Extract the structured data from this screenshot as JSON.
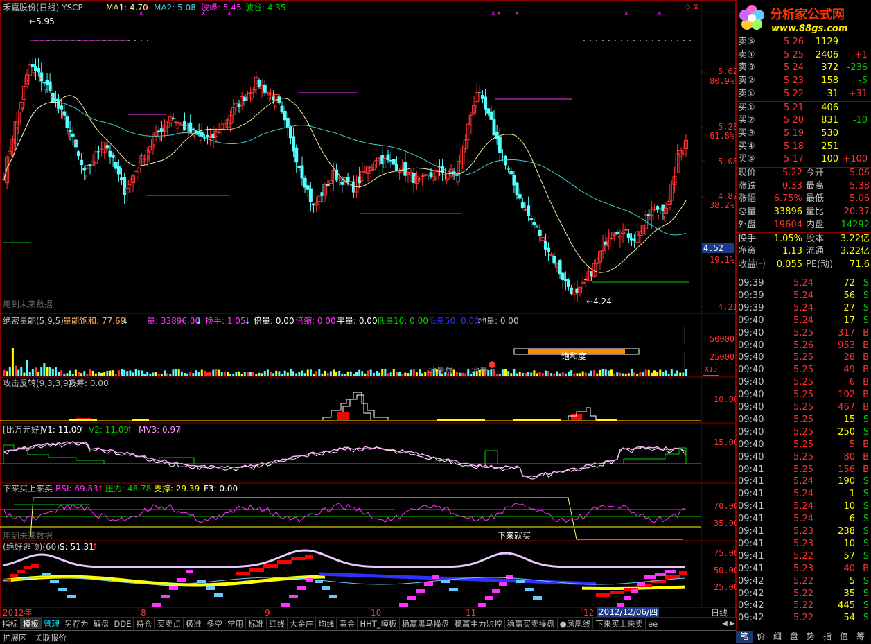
{
  "colors": {
    "up": "#ff3232",
    "down": "#54ffff",
    "bg": "#000000",
    "grid": "#8b0000",
    "yellow": "#ffff00",
    "white": "#ffffff",
    "green": "#00d000",
    "ma1": "#f0f0a0",
    "ma2": "#44cccc",
    "magenta": "#ff33ff",
    "blue": "#3030ff",
    "lightblue": "#66ccff",
    "lavender": "#e6c8ff"
  },
  "main": {
    "title": "禾嘉股份(日线) YSCP",
    "ma1": "MA1: 4.70",
    "ma2": "MA2: 5.03",
    "peak": "波峰: 5.45",
    "valley": "波谷: 4.35",
    "watermark": "用到未来数据",
    "high_label": "5.95",
    "low_label": "4.24",
    "axis": [
      {
        "v": "5.62",
        "c": "#ff3232"
      },
      {
        "v": "80.9%",
        "c": "#ff3232"
      },
      {
        "v": "5.28",
        "c": "#ff3232"
      },
      {
        "v": "61.8%",
        "c": "#ff3232"
      },
      {
        "v": "5.08",
        "c": "#ff3232"
      },
      {
        "v": "4.87",
        "c": "#ff3232"
      },
      {
        "v": "38.2%",
        "c": "#ff3232"
      },
      {
        "v": "19.1%",
        "c": "#ff3232"
      },
      {
        "v": "4.21",
        "c": "#ff3232"
      }
    ],
    "cursor_price": "4.52"
  },
  "chart_data": {
    "type": "candlestick",
    "y_axis": [
      4.21,
      4.87,
      5.08,
      5.28,
      5.62
    ],
    "fib_levels": [
      "19.1%",
      "38.2%",
      "61.8%",
      "80.9%"
    ],
    "high": 5.95,
    "low": 4.24
  },
  "p1": {
    "name": "绝密量能(5,9,5)",
    "sat": "量能饱和: 77.69",
    "vol": "量: 33896.00",
    "turnover": "换手: 1.05",
    "times": "倍量: 0.00",
    "shrink": "倍缩: 0.00",
    "flat": "平量: 0.00",
    "low10": "低量10: 0.00",
    "low50": "低量50: 0.00",
    "ground": "地量: 0.00",
    "axis": [
      "50000",
      "25000"
    ],
    "x10": "X10",
    "saturation_label": "饱和度",
    "ground_group": "地量群",
    "ground_vol": "地量"
  },
  "p2": {
    "name": "攻击反转(9,3,3,9)",
    "chip": "吸筹: 0.00",
    "axis": [
      "10.00"
    ]
  },
  "p3": {
    "name": "[比万元好]",
    "v1": "V1: 11.09",
    "v2": "V2: 11.09",
    "mv3": "MV3: 0.97",
    "axis": [
      "15.00"
    ]
  },
  "p4": {
    "name": "下来买上来卖",
    "rsi": "RSI: 69.83",
    "res": "压力: 48.78",
    "sup": "支撑: 29.39",
    "f3": "F3: 0.00",
    "axis": [
      "70.00",
      "35.00"
    ],
    "watermark": "用到未来数据",
    "note": "下来就买"
  },
  "p5": {
    "name": "(绝好逃顶)(60)",
    "s": "S: 51.31",
    "axis": [
      "75.00",
      "50.00",
      "25.00"
    ]
  },
  "xaxis": {
    "labels": [
      "2012年",
      "8",
      "9",
      "10",
      "11",
      "12"
    ],
    "current": "2012/12/06/四",
    "period": "日线"
  },
  "quote": {
    "asks": [
      {
        "l": "卖⑤",
        "p": "5.26",
        "v": "1129",
        "d": ""
      },
      {
        "l": "卖④",
        "p": "5.25",
        "v": "2406",
        "d": "+1"
      },
      {
        "l": "卖③",
        "p": "5.24",
        "v": "372",
        "d": "-236"
      },
      {
        "l": "卖②",
        "p": "5.23",
        "v": "158",
        "d": "-5"
      },
      {
        "l": "卖①",
        "p": "5.22",
        "v": "31",
        "d": "+31"
      }
    ],
    "bids": [
      {
        "l": "买①",
        "p": "5.21",
        "v": "406",
        "d": ""
      },
      {
        "l": "买②",
        "p": "5.20",
        "v": "831",
        "d": "-10"
      },
      {
        "l": "买③",
        "p": "5.19",
        "v": "530",
        "d": ""
      },
      {
        "l": "买④",
        "p": "5.18",
        "v": "251",
        "d": ""
      },
      {
        "l": "买⑤",
        "p": "5.17",
        "v": "100",
        "d": "+100"
      }
    ],
    "stats": [
      {
        "a": "现价",
        "av": "5.22",
        "ac": "#ff3232",
        "b": "今开",
        "bv": "5.06",
        "bc": "#ff3232"
      },
      {
        "a": "涨跌",
        "av": "0.33",
        "ac": "#ff3232",
        "b": "最高",
        "bv": "5.38",
        "bc": "#ff3232"
      },
      {
        "a": "涨幅",
        "av": "6.75%",
        "ac": "#ff3232",
        "b": "最低",
        "bv": "5.06",
        "bc": "#ff3232"
      },
      {
        "a": "总量",
        "av": "33896",
        "ac": "#ffff00",
        "b": "量比",
        "bv": "20.37",
        "bc": "#ff3232"
      },
      {
        "a": "外盘",
        "av": "19604",
        "ac": "#ff3232",
        "b": "内盘",
        "bv": "14292",
        "bc": "#00d000"
      },
      {
        "a": "换手",
        "av": "1.05%",
        "ac": "#ffff00",
        "b": "股本",
        "bv": "3.22亿",
        "bc": "#ffff00"
      },
      {
        "a": "净资",
        "av": "1.13",
        "ac": "#ffff00",
        "b": "流通",
        "bv": "3.22亿",
        "bc": "#ffff00"
      },
      {
        "a": "收益㈢",
        "av": "0.055",
        "ac": "#ffff00",
        "b": "PE(动)",
        "bv": "71.6",
        "bc": "#ffff00"
      }
    ],
    "ticks": [
      {
        "t": "09:39",
        "p": "5.24",
        "v": "72",
        "s": "S"
      },
      {
        "t": "09:39",
        "p": "5.24",
        "v": "56",
        "s": "S"
      },
      {
        "t": "09:39",
        "p": "5.24",
        "v": "27",
        "s": "S"
      },
      {
        "t": "09:40",
        "p": "5.24",
        "v": "17",
        "s": "S"
      },
      {
        "t": "09:40",
        "p": "5.25",
        "v": "317",
        "s": "B"
      },
      {
        "t": "09:40",
        "p": "5.26",
        "v": "953",
        "s": "B"
      },
      {
        "t": "09:40",
        "p": "5.25",
        "v": "28",
        "s": "B"
      },
      {
        "t": "09:40",
        "p": "5.25",
        "v": "49",
        "s": "B"
      },
      {
        "t": "09:40",
        "p": "5.25",
        "v": "6",
        "s": "B"
      },
      {
        "t": "09:40",
        "p": "5.25",
        "v": "102",
        "s": "B"
      },
      {
        "t": "09:40",
        "p": "5.25",
        "v": "467",
        "s": "B"
      },
      {
        "t": "09:40",
        "p": "5.25",
        "v": "15",
        "s": "S"
      },
      {
        "t": "09:40",
        "p": "5.25",
        "v": "250",
        "s": "S"
      },
      {
        "t": "09:40",
        "p": "5.25",
        "v": "5",
        "s": "B"
      },
      {
        "t": "09:40",
        "p": "5.25",
        "v": "80",
        "s": "B"
      },
      {
        "t": "09:41",
        "p": "5.25",
        "v": "156",
        "s": "B"
      },
      {
        "t": "09:41",
        "p": "5.24",
        "v": "190",
        "s": "S"
      },
      {
        "t": "09:41",
        "p": "5.24",
        "v": "1",
        "s": "S"
      },
      {
        "t": "09:41",
        "p": "5.24",
        "v": "10",
        "s": "S"
      },
      {
        "t": "09:41",
        "p": "5.24",
        "v": "6",
        "s": "S"
      },
      {
        "t": "09:41",
        "p": "5.23",
        "v": "238",
        "s": "S"
      },
      {
        "t": "09:41",
        "p": "5.23",
        "v": "10",
        "s": "S"
      },
      {
        "t": "09:41",
        "p": "5.22",
        "v": "57",
        "s": "S"
      },
      {
        "t": "09:41",
        "p": "5.23",
        "v": "40",
        "s": "B"
      },
      {
        "t": "09:42",
        "p": "5.22",
        "v": "5",
        "s": "S"
      },
      {
        "t": "09:42",
        "p": "5.22",
        "v": "35",
        "s": "S"
      },
      {
        "t": "09:42",
        "p": "5.22",
        "v": "445",
        "s": "S"
      },
      {
        "t": "09:42",
        "p": "5.22",
        "v": "54",
        "s": "S"
      }
    ]
  },
  "logo": {
    "title": "分析家公式网",
    "url": "www.88gs.com"
  },
  "tabs": [
    "指标",
    "模板",
    "管理",
    "另存为",
    "解盘",
    "DDE",
    "持仓",
    "买卖点",
    "极准",
    "多空",
    "常用",
    "标准",
    "红线",
    "大金庄",
    "均线",
    "资金",
    "HHT_模板",
    "稳赢黑马操盘",
    "稳赢主力监控",
    "稳赢买卖操盘",
    "●凤凰线",
    "下来买上来卖",
    "ee"
  ],
  "bottom": {
    "b1": "扩展区",
    "b2": "关联报价"
  },
  "rtabs": [
    "笔",
    "价",
    "细",
    "盘",
    "势",
    "指",
    "值",
    "筹"
  ]
}
